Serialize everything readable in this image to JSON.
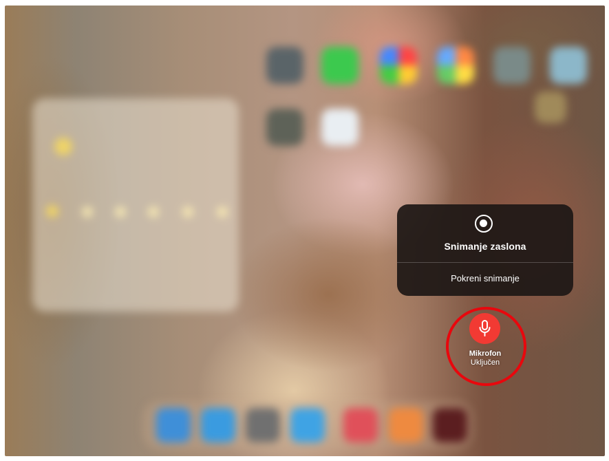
{
  "screen_recording": {
    "icon": "record-icon",
    "title": "Snimanje zaslona",
    "start_label": "Pokreni snimanje"
  },
  "microphone": {
    "icon": "microphone-icon",
    "title": "Mikrofon",
    "status": "Uključen",
    "color": "#f23a33"
  },
  "annotation": {
    "highlight_color": "#e8070d"
  }
}
